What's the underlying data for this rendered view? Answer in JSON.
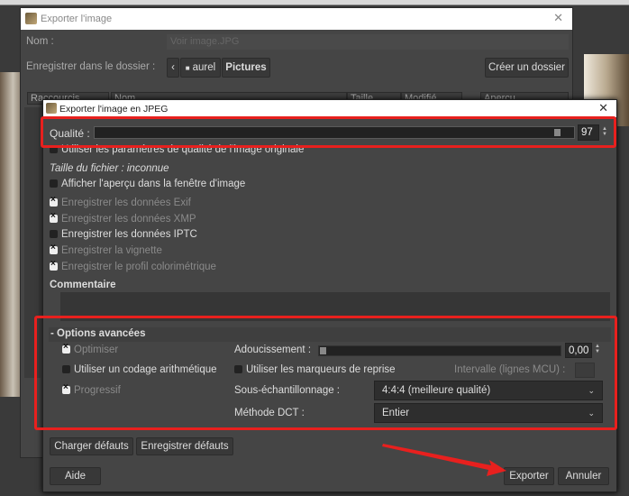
{
  "outer_dialog": {
    "title": "Exporter l'image",
    "name_label": "Nom :",
    "name_value": "Voir image.JPG",
    "folder_label": "Enregistrer dans le dossier :",
    "path": [
      "aurel",
      "Pictures"
    ],
    "create_folder": "Créer un dossier",
    "columns": [
      "Raccourcis",
      "Nom",
      "Taille",
      "Modifié",
      "Aperçu"
    ]
  },
  "jpeg_dialog": {
    "title": "Exporter l'image en JPEG",
    "quality_label": "Qualité :",
    "quality_value": "97",
    "quality_percent": 97,
    "use_original": "Utiliser les paramètres de qualité de l'image originale",
    "file_size": "Taille du fichier : inconnue",
    "options": [
      {
        "label": "Afficher l'aperçu dans la fenêtre d'image",
        "checked": false,
        "enabled": true
      },
      {
        "label": "Enregistrer les données Exif",
        "checked": true,
        "enabled": false
      },
      {
        "label": "Enregistrer les données XMP",
        "checked": true,
        "enabled": false
      },
      {
        "label": "Enregistrer les données IPTC",
        "checked": false,
        "enabled": true
      },
      {
        "label": "Enregistrer la vignette",
        "checked": true,
        "enabled": false
      },
      {
        "label": "Enregistrer le profil colorimétrique",
        "checked": true,
        "enabled": false
      }
    ],
    "comment_label": "Commentaire",
    "advanced": {
      "title": "Options avancées",
      "toggle": "-",
      "optimize": "Optimiser",
      "arithmetic": "Utiliser un codage arithmétique",
      "progressive": "Progressif",
      "smoothing_label": "Adoucissement :",
      "smoothing_value": "0,00",
      "restart_markers": "Utiliser les marqueurs de reprise",
      "interval_label": "Intervalle (lignes MCU) :",
      "subsampling_label": "Sous-échantillonnage :",
      "subsampling_value": "4:4:4 (meilleure qualité)",
      "dct_label": "Méthode DCT :",
      "dct_value": "Entier"
    },
    "load_defaults": "Charger défauts",
    "save_defaults": "Enregistrer défauts",
    "help": "Aide",
    "export": "Exporter",
    "cancel": "Annuler"
  },
  "annotation_color": "#e8201e"
}
